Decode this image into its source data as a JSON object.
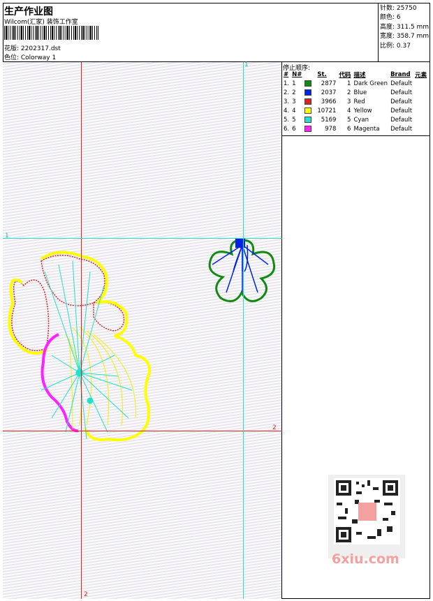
{
  "header": {
    "title": "生产作业图",
    "studio": "Wilcom(汇家) 装饰工作室",
    "design": "花版:  2202317.dst",
    "colorway": "色位:  Colorway 1"
  },
  "stats": [
    {
      "label": "针数",
      "value": "25750"
    },
    {
      "label": "颜色",
      "value": "6"
    },
    {
      "label": "高度",
      "value": "311.5 mm"
    },
    {
      "label": "宽度",
      "value": "358.7 mm"
    },
    {
      "label": "比例",
      "value": "0.37"
    }
  ],
  "stop_sequence": {
    "title": "停止顺序:",
    "columns": [
      "#",
      "N#",
      "St.",
      "代码",
      "描述",
      "Brand",
      "元素"
    ],
    "rows": [
      {
        "idx": "1.",
        "n": "1",
        "stitches": "2877",
        "code": "1",
        "desc": "Dark Green",
        "brand": "Default",
        "color": "#128a12"
      },
      {
        "idx": "2.",
        "n": "2",
        "stitches": "2037",
        "code": "2",
        "desc": "Blue",
        "brand": "Default",
        "color": "#0022e6"
      },
      {
        "idx": "3.",
        "n": "3",
        "stitches": "3966",
        "code": "3",
        "desc": "Red",
        "brand": "Default",
        "color": "#e02020"
      },
      {
        "idx": "4.",
        "n": "4",
        "stitches": "10721",
        "code": "4",
        "desc": "Yellow",
        "brand": "Default",
        "color": "#ffff00"
      },
      {
        "idx": "5.",
        "n": "5",
        "stitches": "5169",
        "code": "5",
        "desc": "Cyan",
        "brand": "Default",
        "color": "#22e0cc"
      },
      {
        "idx": "6.",
        "n": "6",
        "stitches": "978",
        "code": "6",
        "desc": "Magenta",
        "brand": "Default",
        "color": "#ff22ff"
      }
    ]
  },
  "guides": {
    "v1": "1",
    "h1": "1",
    "h2": "2",
    "v2": "2"
  },
  "watermark": "6xiu.com"
}
